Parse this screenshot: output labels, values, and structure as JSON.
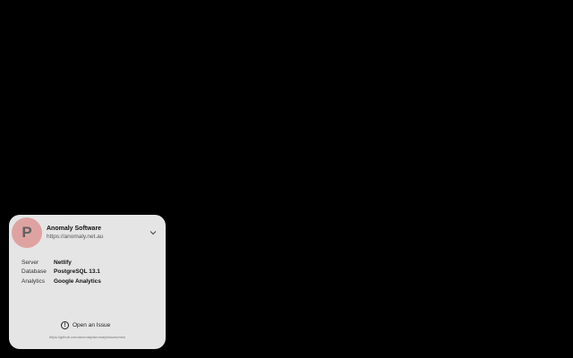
{
  "organization": {
    "avatar_letter": "P",
    "avatar_color": "#dea3a0",
    "name": "Anomaly Software",
    "url": "https://anomaly.net.au",
    "expand_icon": "chevron-down-icon"
  },
  "details": [
    {
      "label": "Server",
      "value": "Netlify"
    },
    {
      "label": "Database",
      "value": "PostgreSQL 13.1"
    },
    {
      "label": "Analytics",
      "value": "Google Analytics"
    }
  ],
  "issue": {
    "icon": "info-icon",
    "icon_glyph": "!",
    "label": "Open an Issue",
    "url": "https://github.com/anomaly/anomaly/issues/new"
  },
  "colors": {
    "background": "#000000",
    "card": "#e5e5e5"
  }
}
